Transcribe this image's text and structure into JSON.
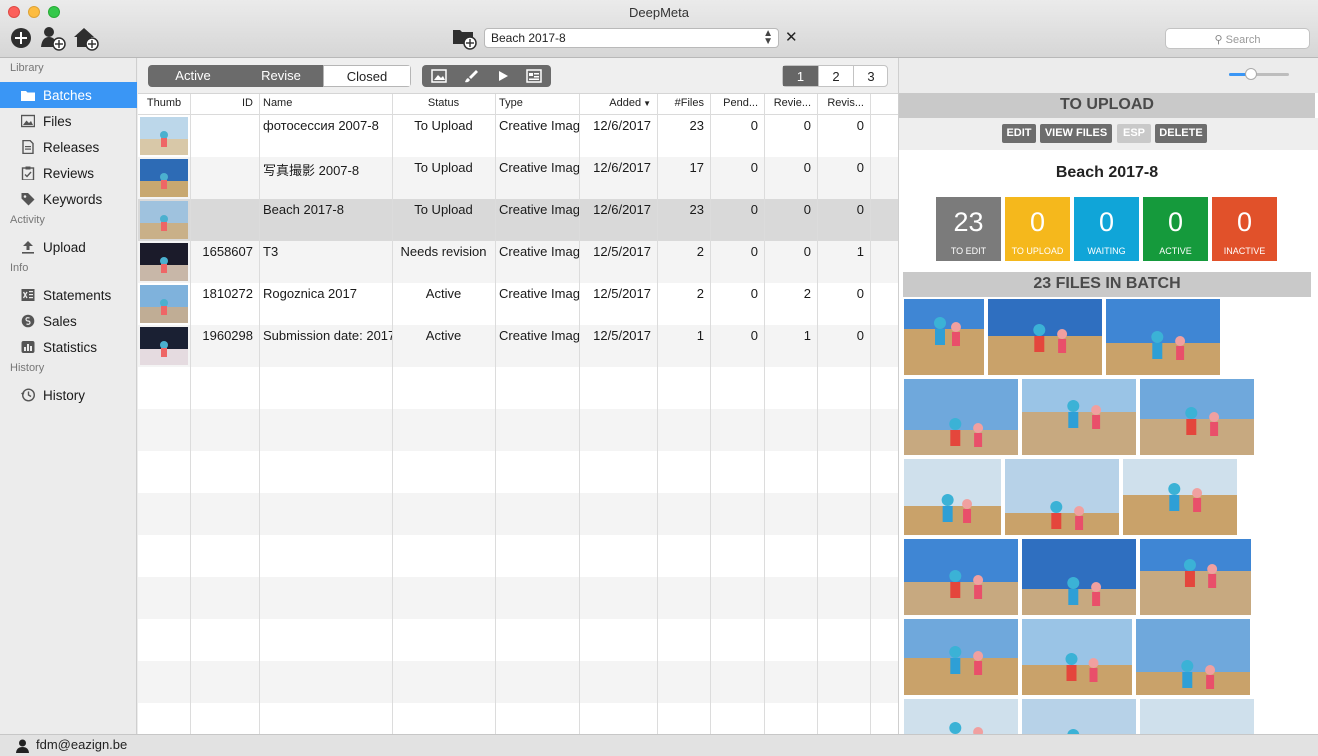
{
  "window": {
    "title": "DeepMeta"
  },
  "toolbar": {
    "batch_select_value": "Beach 2017-8",
    "search_placeholder": "Search"
  },
  "sidebar": {
    "sections": [
      {
        "title": "Library",
        "items": [
          {
            "label": "Batches",
            "icon": "folder-icon",
            "selected": true
          },
          {
            "label": "Files",
            "icon": "image-icon"
          },
          {
            "label": "Releases",
            "icon": "document-icon"
          },
          {
            "label": "Reviews",
            "icon": "clipboard-icon"
          },
          {
            "label": "Keywords",
            "icon": "tag-icon"
          }
        ]
      },
      {
        "title": "Activity",
        "items": [
          {
            "label": "Upload",
            "icon": "upload-icon"
          }
        ]
      },
      {
        "title": "Info",
        "items": [
          {
            "label": "Statements",
            "icon": "spreadsheet-icon"
          },
          {
            "label": "Sales",
            "icon": "coin-icon"
          },
          {
            "label": "Statistics",
            "icon": "bar-chart-icon"
          }
        ]
      },
      {
        "title": "History",
        "items": [
          {
            "label": "History",
            "icon": "clock-icon"
          }
        ]
      }
    ]
  },
  "filter_tabs": [
    "Active",
    "Revise",
    "Closed"
  ],
  "filter_selected": "Closed",
  "view_buttons": [
    "image-icon",
    "brush-icon",
    "play-icon",
    "list-view-icon"
  ],
  "pages": [
    "1",
    "2",
    "3"
  ],
  "page_selected": "1",
  "table": {
    "columns": [
      "Thumb",
      "ID",
      "Name",
      "Status",
      "Type",
      "Added",
      "#Files",
      "Pend...",
      "Revie...",
      "Revis..."
    ],
    "sort_column": "Added",
    "rows": [
      {
        "id": "",
        "name": "фотосессия 2007-8",
        "status": "To Upload",
        "type": "Creative Imag",
        "added": "12/6/2017",
        "files": "23",
        "pending": "0",
        "reviewed": "0",
        "revision": "0"
      },
      {
        "id": "",
        "name": "写真撮影 2007-8",
        "status": "To Upload",
        "type": "Creative Imag",
        "added": "12/6/2017",
        "files": "17",
        "pending": "0",
        "reviewed": "0",
        "revision": "0"
      },
      {
        "id": "",
        "name": "Beach 2017-8",
        "status": "To Upload",
        "type": "Creative Imag",
        "added": "12/6/2017",
        "files": "23",
        "pending": "0",
        "reviewed": "0",
        "revision": "0"
      },
      {
        "id": "1658607",
        "name": "T3",
        "status": "Needs revision",
        "type": "Creative Imag",
        "added": "12/5/2017",
        "files": "2",
        "pending": "0",
        "reviewed": "0",
        "revision": "1"
      },
      {
        "id": "1810272",
        "name": "Rogoznica 2017",
        "status": "Active",
        "type": "Creative Imag",
        "added": "12/5/2017",
        "files": "2",
        "pending": "0",
        "reviewed": "2",
        "revision": "0"
      },
      {
        "id": "1960298",
        "name": "Submission date: 2017",
        "status": "Active",
        "type": "Creative Imag",
        "added": "12/5/2017",
        "files": "1",
        "pending": "0",
        "reviewed": "1",
        "revision": "0"
      }
    ]
  },
  "detail": {
    "status_header": "TO UPLOAD",
    "actions": [
      "EDIT",
      "VIEW FILES",
      "ESP",
      "DELETE"
    ],
    "batch_name": "Beach 2017-8",
    "stats": [
      {
        "value": "23",
        "label": "TO EDIT",
        "color": "#7b7b7b"
      },
      {
        "value": "0",
        "label": "TO UPLOAD",
        "color": "#f5b81c"
      },
      {
        "value": "0",
        "label": "WAITING",
        "color": "#10a5d8"
      },
      {
        "value": "0",
        "label": "ACTIVE",
        "color": "#159a3c"
      },
      {
        "value": "0",
        "label": "INACTIVE",
        "color": "#e1512a"
      }
    ],
    "files_header": "23 FILES IN BATCH"
  },
  "footer": {
    "user": "fdm@eazign.be"
  }
}
